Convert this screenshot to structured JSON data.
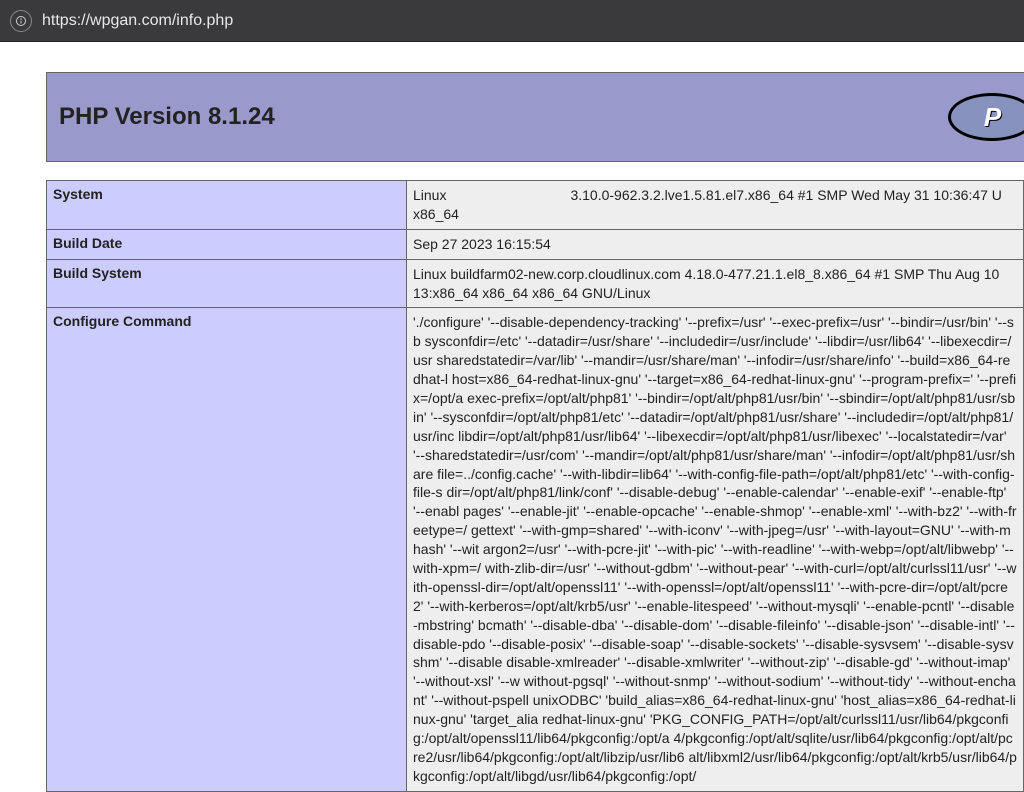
{
  "browser": {
    "url": "https://wpgan.com/info.php"
  },
  "header": {
    "title": "PHP Version 8.1.24",
    "logo_text": "P"
  },
  "rows": {
    "system": {
      "label": "System",
      "value_left": "Linux",
      "value_right": "3.10.0-962.3.2.lve1.5.81.el7.x86_64 #1 SMP Wed May 31 10:36:47 U",
      "value_line2": "x86_64"
    },
    "build_date": {
      "label": "Build Date",
      "value": "Sep 27 2023 16:15:54"
    },
    "build_system": {
      "label": "Build System",
      "value": "Linux buildfarm02-new.corp.cloudlinux.com 4.18.0-477.21.1.el8_8.x86_64 #1 SMP Thu Aug 10 13:​x86_64 x86_64 x86_64 GNU/Linux"
    },
    "configure": {
      "label": "Configure Command",
      "value": "'./configure' '--disable-dependency-tracking' '--prefix=/usr' '--exec-prefix=/usr' '--bindir=/usr/bin' '--sb sysconfdir=/etc' '--datadir=/usr/share' '--includedir=/usr/include' '--libdir=/usr/lib64' '--libexecdir=/usr sharedstatedir=/var/lib' '--mandir=/usr/share/man' '--infodir=/usr/share/info' '--build=x86_64-redhat-l host=x86_64-redhat-linux-gnu' '--target=x86_64-redhat-linux-gnu' '--program-prefix=' '--prefix=/opt/a exec-prefix=/opt/alt/php81' '--bindir=/opt/alt/php81/usr/bin' '--sbindir=/opt/alt/php81/usr/sbin' '--sysconfdir=/opt/alt/php81/etc' '--datadir=/opt/alt/php81/usr/share' '--includedir=/opt/alt/php81/usr/inc libdir=/opt/alt/php81/usr/lib64' '--libexecdir=/opt/alt/php81/usr/libexec' '--localstatedir=/var' '--sharedstatedir=/usr/com' '--mandir=/opt/alt/php81/usr/share/man' '--infodir=/opt/alt/php81/usr/share file=../config.cache' '--with-libdir=lib64' '--with-config-file-path=/opt/alt/php81/etc' '--with-config-file-s dir=/opt/alt/php81/link/conf' '--disable-debug' '--enable-calendar' '--enable-exif' '--enable-ftp' '--enabl pages' '--enable-jit' '--enable-opcache' '--enable-shmop' '--enable-xml' '--with-bz2' '--with-freetype=/ gettext' '--with-gmp=shared' '--with-iconv' '--with-jpeg=/usr' '--with-layout=GNU' '--with-mhash' '--wit argon2=/usr' '--with-pcre-jit' '--with-pic' '--with-readline' '--with-webp=/opt/alt/libwebp' '--with-xpm=/ with-zlib-dir=/usr' '--without-gdbm' '--without-pear' '--with-curl=/opt/alt/curlssl11/usr' '--with-openssl-dir=/opt/alt/openssl11' '--with-openssl=/opt/alt/openssl11' '--with-pcre-dir=/opt/alt/pcre2' '--with-kerberos=/opt/alt/krb5/usr' '--enable-litespeed' '--without-mysqli' '--enable-pcntl' '--disable-mbstring' bcmath' '--disable-dba' '--disable-dom' '--disable-fileinfo' '--disable-json' '--disable-intl' '--disable-pdo '--disable-posix' '--disable-soap' '--disable-sockets' '--disable-sysvsem' '--disable-sysvshm' '--disable disable-xmlreader' '--disable-xmlwriter' '--without-zip' '--disable-gd' '--without-imap' '--without-xsl' '--w without-pgsql' '--without-snmp' '--without-sodium' '--without-tidy' '--without-enchant' '--without-pspell unixODBC' 'build_alias=x86_64-redhat-linux-gnu' 'host_alias=x86_64-redhat-linux-gnu' 'target_alia redhat-linux-gnu' 'PKG_CONFIG_PATH=/opt/alt/curlssl11/usr/lib64/pkgconfig:/opt/alt/openssl11/lib64/pkgconfig:/opt/a 4/pkgconfig:/opt/alt/sqlite/usr/lib64/pkgconfig:/opt/alt/pcre2/usr/lib64/pkgconfig:/opt/alt/libzip/usr/lib6 alt/libxml2/usr/lib64/pkgconfig:/opt/alt/krb5/usr/lib64/pkgconfig:/opt/alt/libgd/usr/lib64/pkgconfig:/opt/"
    }
  }
}
